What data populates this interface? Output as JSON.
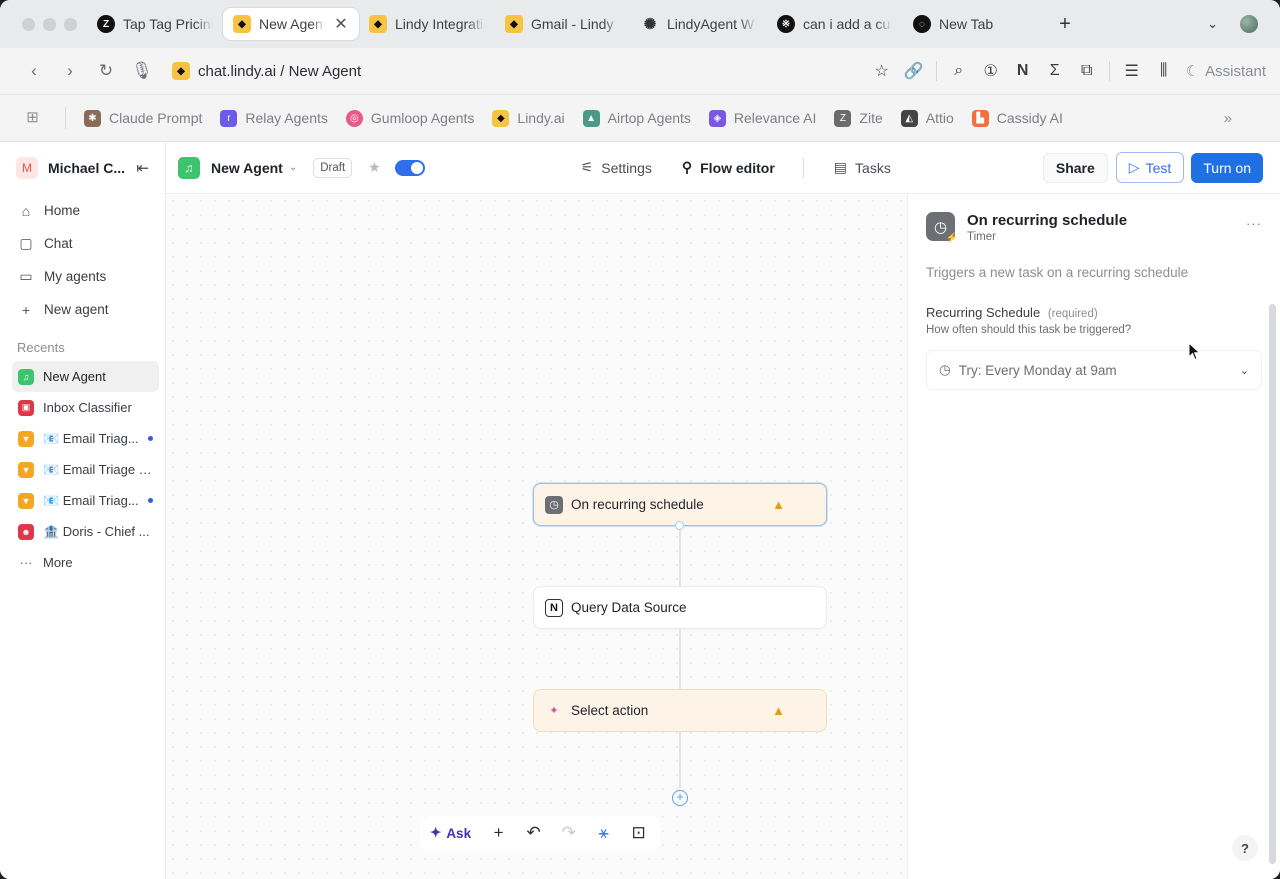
{
  "browser": {
    "tabs": [
      {
        "title": "Tap Tag Pricing",
        "favicon": "dark-z-icon"
      },
      {
        "title": "New Agent",
        "favicon": "lindy-icon",
        "active": true
      },
      {
        "title": "Lindy Integrations",
        "favicon": "lindy-icon"
      },
      {
        "title": "Gmail - Lindy",
        "favicon": "lindy-icon"
      },
      {
        "title": "LindyAgent W",
        "favicon": "openai-icon"
      },
      {
        "title": "can i add a cu",
        "favicon": "dark-glyph-icon"
      },
      {
        "title": "New Tab",
        "favicon": "dark-swirl-icon"
      }
    ],
    "url": "chat.lindy.ai / New Agent",
    "assistant_label": "Assistant",
    "bookmarks": [
      {
        "label": "Claude Prompt",
        "color": "#8a6b5a"
      },
      {
        "label": "Relay Agents",
        "color": "#6b5ce7"
      },
      {
        "label": "Gumloop Agents",
        "color": "#e85a8a"
      },
      {
        "label": "Lindy.ai",
        "color": "#f6c342"
      },
      {
        "label": "Airtop Agents",
        "color": "#4a9a86"
      },
      {
        "label": "Relevance AI",
        "color": "#7b57e6"
      },
      {
        "label": "Zite",
        "color": "#6b6b6b"
      },
      {
        "label": "Attio",
        "color": "#444444"
      },
      {
        "label": "Cassidy AI",
        "color": "#f07040"
      }
    ]
  },
  "sidebar": {
    "user_initial": "M",
    "user_name": "Michael C...",
    "nav": [
      {
        "label": "Home",
        "icon": "home-icon"
      },
      {
        "label": "Chat",
        "icon": "chat-icon"
      },
      {
        "label": "My agents",
        "icon": "folder-icon"
      },
      {
        "label": "New agent",
        "icon": "plus-icon"
      }
    ],
    "recents_label": "Recents",
    "recents": [
      {
        "label": "New Agent",
        "color": "#3ec46d",
        "active": true,
        "dot": false
      },
      {
        "label": "Inbox Classifier",
        "color": "#e0364a",
        "dot": false
      },
      {
        "label": "📧 Email Triag...",
        "color": "#f5a623",
        "dot": true
      },
      {
        "label": "📧 Email Triage -...",
        "color": "#f5a623",
        "dot": false
      },
      {
        "label": "📧 Email Triag...",
        "color": "#f5a623",
        "dot": true
      },
      {
        "label": "🏦 Doris - Chief ...",
        "color": "#e0364a",
        "dot": false
      }
    ],
    "more_label": "More"
  },
  "toolbar": {
    "agent_name": "New Agent",
    "status_badge": "Draft",
    "tabs": [
      "Settings",
      "Flow editor",
      "Tasks"
    ],
    "share_label": "Share",
    "test_label": "Test",
    "turn_on_label": "Turn on",
    "enabled": true
  },
  "canvas": {
    "nodes": [
      {
        "label": "On recurring schedule",
        "state": "warning-selected",
        "icon": "clock-icon"
      },
      {
        "label": "Query Data Source",
        "state": "normal",
        "icon": "notion-icon"
      },
      {
        "label": "Select action",
        "state": "warning",
        "icon": "sparkle-icon"
      }
    ],
    "tools": {
      "ask_label": "Ask"
    }
  },
  "panel": {
    "title": "On recurring schedule",
    "subtitle": "Timer",
    "description": "Triggers a new task on a recurring schedule",
    "field_label": "Recurring Schedule",
    "field_required": "(required)",
    "field_help": "How often should this task be triggered?",
    "field_placeholder": "Try: Every Monday at 9am",
    "help_label": "?"
  }
}
